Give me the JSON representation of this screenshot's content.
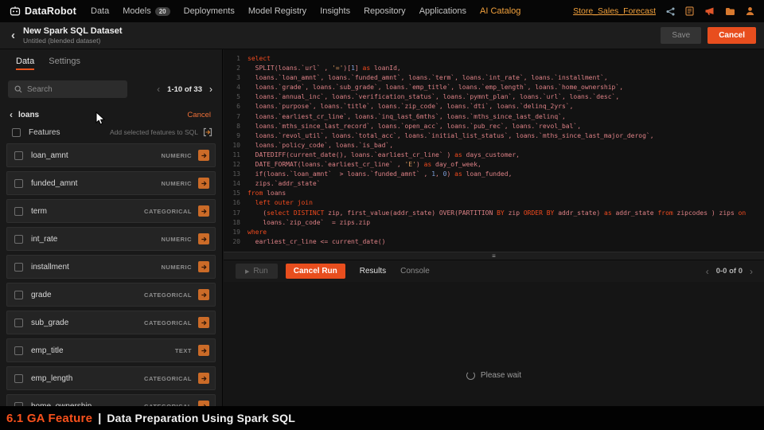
{
  "colors": {
    "accent_orange": "#e84e1e",
    "nav_active": "#f2a13c",
    "banner_highlight": "#f8511c",
    "sql_keyword": "#f14a1e",
    "sql_text": "#dd8186"
  },
  "topnav": {
    "brand": "DataRobot",
    "items": [
      {
        "label": "Data"
      },
      {
        "label": "Models",
        "badge": "20"
      },
      {
        "label": "Deployments"
      },
      {
        "label": "Model Registry"
      },
      {
        "label": "Insights"
      },
      {
        "label": "Repository"
      },
      {
        "label": "Applications"
      },
      {
        "label": "AI Catalog",
        "active": true
      }
    ],
    "project_link": "Store_Sales_Forecast"
  },
  "header": {
    "title": "New Spark SQL Dataset",
    "subtitle": "Untitled (blended dataset)",
    "save_label": "Save",
    "cancel_label": "Cancel"
  },
  "sidebar": {
    "tabs": [
      "Data",
      "Settings"
    ],
    "search_placeholder": "Search",
    "pagination": "1-10 of 33",
    "group_label": "loans",
    "group_cancel": "Cancel",
    "features_label": "Features",
    "features_hint": "Add selected features to SQL",
    "features": [
      {
        "name": "loan_amnt",
        "type": "NUMERIC"
      },
      {
        "name": "funded_amnt",
        "type": "NUMERIC"
      },
      {
        "name": "term",
        "type": "CATEGORICAL"
      },
      {
        "name": "int_rate",
        "type": "NUMERIC"
      },
      {
        "name": "installment",
        "type": "NUMERIC"
      },
      {
        "name": "grade",
        "type": "CATEGORICAL"
      },
      {
        "name": "sub_grade",
        "type": "CATEGORICAL"
      },
      {
        "name": "emp_title",
        "type": "TEXT"
      },
      {
        "name": "emp_length",
        "type": "CATEGORICAL"
      },
      {
        "name": "home_ownership",
        "type": "CATEGORICAL"
      }
    ]
  },
  "editor": {
    "lines": [
      [
        [
          "k",
          "select"
        ]
      ],
      [
        [
          "p",
          "  SPLIT(loans.`url` , "
        ],
        [
          "s",
          "'='"
        ],
        [
          "p",
          ")["
        ],
        [
          "n",
          "1"
        ],
        [
          "p",
          "] "
        ],
        [
          "k",
          "as"
        ],
        [
          "p",
          " loanId,"
        ]
      ],
      [
        [
          "p",
          "  loans.`loan_amnt`, loans.`funded_amnt`, loans.`term`, loans.`int_rate`, loans.`installment`,"
        ]
      ],
      [
        [
          "p",
          "  loans.`grade`, loans.`sub_grade`, loans.`emp_title`, loans.`emp_length`, loans.`home_ownership`,"
        ]
      ],
      [
        [
          "p",
          "  loans.`annual_inc`, loans.`verification_status`, loans.`pymnt_plan`, loans.`url`, loans.`desc`,"
        ]
      ],
      [
        [
          "p",
          "  loans.`purpose`, loans.`title`, loans.`zip_code`, loans.`dti`, loans.`delinq_2yrs`,"
        ]
      ],
      [
        [
          "p",
          "  loans.`earliest_cr_line`, loans.`inq_last_6mths`, loans.`mths_since_last_delinq`,"
        ]
      ],
      [
        [
          "p",
          "  loans.`mths_since_last_record`, loans.`open_acc`, loans.`pub_rec`, loans.`revol_bal`,"
        ]
      ],
      [
        [
          "p",
          "  loans.`revol_util`, loans.`total_acc`, loans.`initial_list_status`, loans.`mths_since_last_major_derog`,"
        ]
      ],
      [
        [
          "p",
          "  loans.`policy_code`, loans.`is_bad`,"
        ]
      ],
      [
        [
          "p",
          "  DATEDIFF(current_date(), loans.`earliest_cr_line` ) "
        ],
        [
          "k",
          "as"
        ],
        [
          "p",
          " days_customer,"
        ]
      ],
      [
        [
          "p",
          "  DATE_FORMAT(loans.`earliest_cr_line` , "
        ],
        [
          "s",
          "'E'"
        ],
        [
          "p",
          ") "
        ],
        [
          "k",
          "as"
        ],
        [
          "p",
          " day_of_week,"
        ]
      ],
      [
        [
          "p",
          "  if(loans.`loan_amnt`  > loans.`funded_amnt` , "
        ],
        [
          "n",
          "1"
        ],
        [
          "p",
          ", "
        ],
        [
          "n",
          "0"
        ],
        [
          "p",
          ") "
        ],
        [
          "k",
          "as"
        ],
        [
          "p",
          " loan_funded,"
        ]
      ],
      [
        [
          "p",
          "  zips.`addr_state`"
        ]
      ],
      [
        [
          "k",
          "from"
        ],
        [
          "p",
          " loans"
        ]
      ],
      [
        [
          "p",
          "  "
        ],
        [
          "k",
          "left outer join"
        ]
      ],
      [
        [
          "p",
          "    ("
        ],
        [
          "k",
          "select"
        ],
        [
          "p",
          " "
        ],
        [
          "k",
          "DISTINCT"
        ],
        [
          "p",
          " zip, first_value(addr_state) OVER(PARTITION "
        ],
        [
          "k",
          "BY"
        ],
        [
          "p",
          " zip "
        ],
        [
          "k",
          "ORDER BY"
        ],
        [
          "p",
          " addr_state) "
        ],
        [
          "k",
          "as"
        ],
        [
          "p",
          " addr_state "
        ],
        [
          "k",
          "from"
        ],
        [
          "p",
          " zipcodes ) zips "
        ],
        [
          "k",
          "on"
        ]
      ],
      [
        [
          "p",
          "    loans.`zip_code`  = zips.zip"
        ]
      ],
      [
        [
          "k",
          "where"
        ]
      ],
      [
        [
          "p",
          "  earliest_cr_line <= current_date()"
        ]
      ]
    ]
  },
  "results": {
    "run_label": "Run",
    "cancel_run_label": "Cancel Run",
    "tabs": [
      "Results",
      "Console"
    ],
    "pagination": "0-0 of 0",
    "loading_text": "Please wait"
  },
  "banner": {
    "highlight": "6.1 GA Feature",
    "separator": "|",
    "text": "Data Preparation Using Spark SQL"
  }
}
